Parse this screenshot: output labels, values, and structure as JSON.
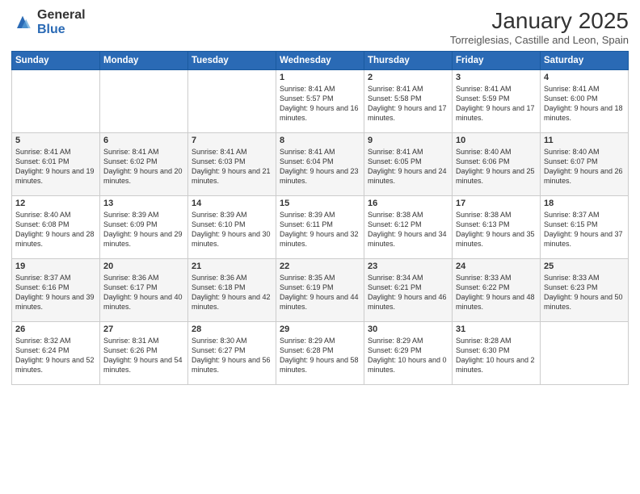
{
  "logo": {
    "general": "General",
    "blue": "Blue"
  },
  "title": "January 2025",
  "subtitle": "Torreiglesias, Castille and Leon, Spain",
  "days_header": [
    "Sunday",
    "Monday",
    "Tuesday",
    "Wednesday",
    "Thursday",
    "Friday",
    "Saturday"
  ],
  "weeks": [
    [
      {
        "day": "",
        "text": ""
      },
      {
        "day": "",
        "text": ""
      },
      {
        "day": "",
        "text": ""
      },
      {
        "day": "1",
        "text": "Sunrise: 8:41 AM\nSunset: 5:57 PM\nDaylight: 9 hours and 16 minutes."
      },
      {
        "day": "2",
        "text": "Sunrise: 8:41 AM\nSunset: 5:58 PM\nDaylight: 9 hours and 17 minutes."
      },
      {
        "day": "3",
        "text": "Sunrise: 8:41 AM\nSunset: 5:59 PM\nDaylight: 9 hours and 17 minutes."
      },
      {
        "day": "4",
        "text": "Sunrise: 8:41 AM\nSunset: 6:00 PM\nDaylight: 9 hours and 18 minutes."
      }
    ],
    [
      {
        "day": "5",
        "text": "Sunrise: 8:41 AM\nSunset: 6:01 PM\nDaylight: 9 hours and 19 minutes."
      },
      {
        "day": "6",
        "text": "Sunrise: 8:41 AM\nSunset: 6:02 PM\nDaylight: 9 hours and 20 minutes."
      },
      {
        "day": "7",
        "text": "Sunrise: 8:41 AM\nSunset: 6:03 PM\nDaylight: 9 hours and 21 minutes."
      },
      {
        "day": "8",
        "text": "Sunrise: 8:41 AM\nSunset: 6:04 PM\nDaylight: 9 hours and 23 minutes."
      },
      {
        "day": "9",
        "text": "Sunrise: 8:41 AM\nSunset: 6:05 PM\nDaylight: 9 hours and 24 minutes."
      },
      {
        "day": "10",
        "text": "Sunrise: 8:40 AM\nSunset: 6:06 PM\nDaylight: 9 hours and 25 minutes."
      },
      {
        "day": "11",
        "text": "Sunrise: 8:40 AM\nSunset: 6:07 PM\nDaylight: 9 hours and 26 minutes."
      }
    ],
    [
      {
        "day": "12",
        "text": "Sunrise: 8:40 AM\nSunset: 6:08 PM\nDaylight: 9 hours and 28 minutes."
      },
      {
        "day": "13",
        "text": "Sunrise: 8:39 AM\nSunset: 6:09 PM\nDaylight: 9 hours and 29 minutes."
      },
      {
        "day": "14",
        "text": "Sunrise: 8:39 AM\nSunset: 6:10 PM\nDaylight: 9 hours and 30 minutes."
      },
      {
        "day": "15",
        "text": "Sunrise: 8:39 AM\nSunset: 6:11 PM\nDaylight: 9 hours and 32 minutes."
      },
      {
        "day": "16",
        "text": "Sunrise: 8:38 AM\nSunset: 6:12 PM\nDaylight: 9 hours and 34 minutes."
      },
      {
        "day": "17",
        "text": "Sunrise: 8:38 AM\nSunset: 6:13 PM\nDaylight: 9 hours and 35 minutes."
      },
      {
        "day": "18",
        "text": "Sunrise: 8:37 AM\nSunset: 6:15 PM\nDaylight: 9 hours and 37 minutes."
      }
    ],
    [
      {
        "day": "19",
        "text": "Sunrise: 8:37 AM\nSunset: 6:16 PM\nDaylight: 9 hours and 39 minutes."
      },
      {
        "day": "20",
        "text": "Sunrise: 8:36 AM\nSunset: 6:17 PM\nDaylight: 9 hours and 40 minutes."
      },
      {
        "day": "21",
        "text": "Sunrise: 8:36 AM\nSunset: 6:18 PM\nDaylight: 9 hours and 42 minutes."
      },
      {
        "day": "22",
        "text": "Sunrise: 8:35 AM\nSunset: 6:19 PM\nDaylight: 9 hours and 44 minutes."
      },
      {
        "day": "23",
        "text": "Sunrise: 8:34 AM\nSunset: 6:21 PM\nDaylight: 9 hours and 46 minutes."
      },
      {
        "day": "24",
        "text": "Sunrise: 8:33 AM\nSunset: 6:22 PM\nDaylight: 9 hours and 48 minutes."
      },
      {
        "day": "25",
        "text": "Sunrise: 8:33 AM\nSunset: 6:23 PM\nDaylight: 9 hours and 50 minutes."
      }
    ],
    [
      {
        "day": "26",
        "text": "Sunrise: 8:32 AM\nSunset: 6:24 PM\nDaylight: 9 hours and 52 minutes."
      },
      {
        "day": "27",
        "text": "Sunrise: 8:31 AM\nSunset: 6:26 PM\nDaylight: 9 hours and 54 minutes."
      },
      {
        "day": "28",
        "text": "Sunrise: 8:30 AM\nSunset: 6:27 PM\nDaylight: 9 hours and 56 minutes."
      },
      {
        "day": "29",
        "text": "Sunrise: 8:29 AM\nSunset: 6:28 PM\nDaylight: 9 hours and 58 minutes."
      },
      {
        "day": "30",
        "text": "Sunrise: 8:29 AM\nSunset: 6:29 PM\nDaylight: 10 hours and 0 minutes."
      },
      {
        "day": "31",
        "text": "Sunrise: 8:28 AM\nSunset: 6:30 PM\nDaylight: 10 hours and 2 minutes."
      },
      {
        "day": "",
        "text": ""
      }
    ]
  ]
}
